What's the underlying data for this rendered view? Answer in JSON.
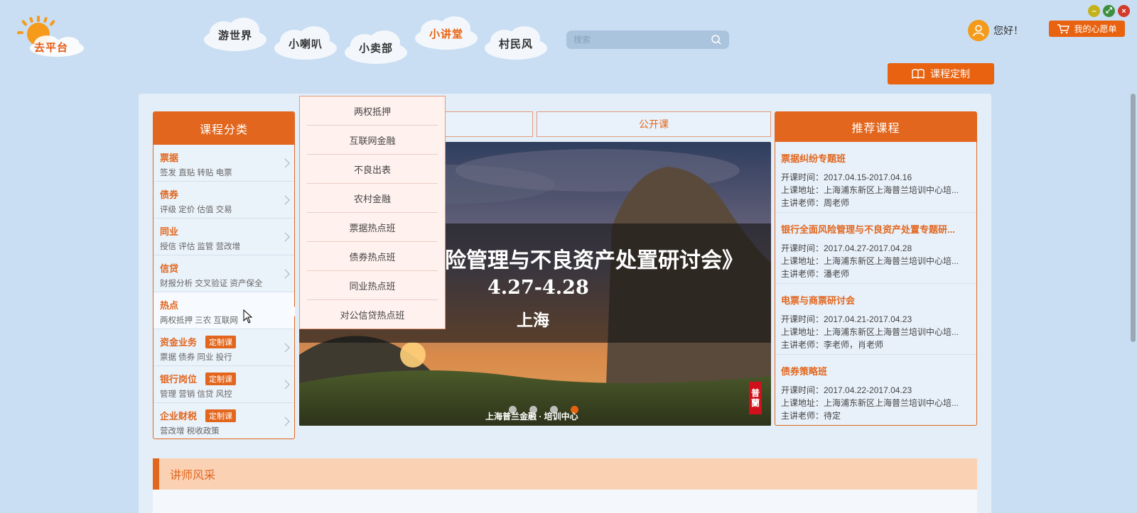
{
  "header": {
    "logo_text": "去平台",
    "nav": [
      {
        "label": "游世界",
        "active": false
      },
      {
        "label": "小喇叭",
        "active": false
      },
      {
        "label": "小卖部",
        "active": false
      },
      {
        "label": "小讲堂",
        "active": true
      },
      {
        "label": "村民风",
        "active": false
      }
    ],
    "search_placeholder": "搜索",
    "greeting": "您好！",
    "wishlist_label": "我的心愿单",
    "custom_course_label": "课程定制"
  },
  "window_controls": {
    "minimize": "–",
    "restore": "⤢",
    "close": "×"
  },
  "categories": {
    "title": "课程分类",
    "items": [
      {
        "title": "票据",
        "sub": "签发 直贴 转贴 电票",
        "tag": ""
      },
      {
        "title": "债券",
        "sub": "评级 定价 估值 交易",
        "tag": ""
      },
      {
        "title": "同业",
        "sub": "授信 评估 监管 营改增",
        "tag": ""
      },
      {
        "title": "信贷",
        "sub": "财报分析 交叉验证 资产保全",
        "tag": ""
      },
      {
        "title": "热点",
        "sub": "两权抵押 三农 互联网",
        "tag": ""
      },
      {
        "title": "资金业务",
        "sub": "票据 债券 同业 投行",
        "tag": "定制课"
      },
      {
        "title": "银行岗位",
        "sub": "管理 营销 信贷 风控",
        "tag": "定制课"
      },
      {
        "title": "企业财税",
        "sub": "营改增 税收政策",
        "tag": "定制课"
      }
    ]
  },
  "popup": {
    "items": [
      "两权抵押",
      "互联网金融",
      "不良出表",
      "农村金融",
      "票据热点班",
      "债券热点班",
      "同业热点班",
      "对公信贷热点班"
    ]
  },
  "tabs": {
    "public_course": "公开课"
  },
  "banner": {
    "title": "险管理与不良资产处置研讨会》",
    "date": "4.27-4.28",
    "place": "上海",
    "footer": "上海普兰金融 · 培训中心",
    "seal_1": "普",
    "seal_2": "蘭",
    "slide_count": 4,
    "active_slide": 4
  },
  "recommended": {
    "title": "推荐课程",
    "items": [
      {
        "title": "票据纠纷专题班",
        "time": "开课时间：2017.04.15-2017.04.16",
        "address": "上课地址：上海浦东新区上海普兰培训中心培...",
        "teacher": "主讲老师：周老师"
      },
      {
        "title": "银行全面风险管理与不良资产处置专题研...",
        "time": "开课时间：2017.04.27-2017.04.28",
        "address": "上课地址：上海浦东新区上海普兰培训中心培...",
        "teacher": "主讲老师：潘老师"
      },
      {
        "title": "电票与商票研讨会",
        "time": "开课时间：2017.04.21-2017.04.23",
        "address": "上课地址：上海浦东新区上海普兰培训中心培...",
        "teacher": "主讲老师：李老师，肖老师"
      },
      {
        "title": "债券策略班",
        "time": "开课时间：2017.04.22-2017.04.23",
        "address": "上课地址：上海浦东新区上海普兰培训中心培...",
        "teacher": "主讲老师：待定"
      }
    ]
  },
  "teacher_section": {
    "title": "讲师风采"
  },
  "colors": {
    "accent": "#e2661d",
    "background": "#c9def3",
    "panel": "#e3eef9"
  }
}
